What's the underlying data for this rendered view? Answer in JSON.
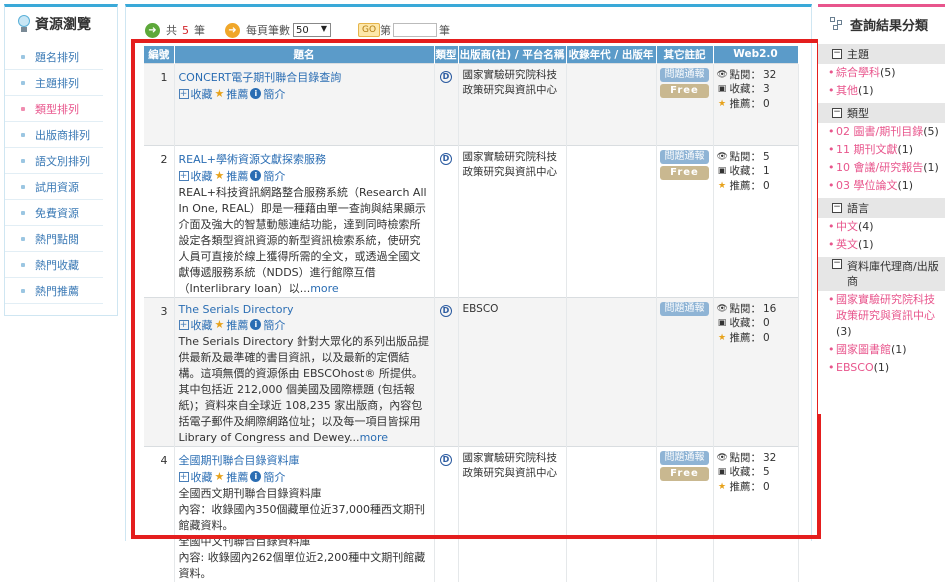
{
  "left": {
    "title": "資源瀏覽",
    "items": [
      "題名排列",
      "主題排列",
      "類型排列",
      "出版商排列",
      "語文別排列",
      "試用資源",
      "免費資源",
      "熱門點閱",
      "熱門收藏",
      "熱門推薦"
    ],
    "active_index": 2
  },
  "pager": {
    "total_prefix": "共",
    "total": "5",
    "total_suffix": "筆",
    "per_page_label": "每頁筆數",
    "per_page": "50",
    "go": "GO",
    "page_prefix": "第",
    "page_suffix": "筆"
  },
  "table": {
    "headers": [
      "編號",
      "題名",
      "類型",
      "出版商(社) / 平台名稱",
      "收錄年代 / 出版年",
      "其它註記",
      "Web2.0"
    ],
    "action_collect": "收藏",
    "action_recommend": "推薦",
    "action_intro": "簡介",
    "tag_notify": "問題通報",
    "tag_free": "Free",
    "label_views": "點閱：",
    "label_collect": "收藏：",
    "label_recommend": "推薦：",
    "type_letter": "D",
    "rows": [
      {
        "no": "1",
        "title": "CONCERT電子期刊聯合目錄查詢",
        "desc": "",
        "more": "",
        "publisher": "國家實驗研究院科技政策研究與資訊中心",
        "free": true,
        "views": "32",
        "collects": "3",
        "recommends": "0"
      },
      {
        "no": "2",
        "title": "REAL+學術資源文獻探索服務",
        "desc": "REAL+科技資訊網路整合服務系統（Research All In One, REAL）即是一種藉由單一查詢與結果顯示介面及強大的智慧動態連結功能，達到同時檢索所設定各類型資訊資源的新型資訊檢索系統，使研究人員可直接於線上獲得所需的全文，或透過全國文獻傳遞服務系統（NDDS）進行館際互借（Interlibrary loan）以...",
        "more": "more",
        "publisher": "國家實驗研究院科技政策研究與資訊中心",
        "free": true,
        "views": "5",
        "collects": "1",
        "recommends": "0"
      },
      {
        "no": "3",
        "title": "The Serials Directory",
        "desc": "The Serials Directory 針對大眾化的系列出版品提供最新及最準確的書目資訊，以及最新的定價結構。這項無價的資源係由 EBSCOhost® 所提供。其中包括近 212,000 個美國及國際標題 (包括報紙)；資料來自全球近 108,235 家出版商，內容包括電子郵件及網際網路位址；以及每一項目皆採用Library of Congress and Dewey...",
        "more": "more",
        "publisher": "EBSCO",
        "free": false,
        "views": "16",
        "collects": "0",
        "recommends": "0"
      },
      {
        "no": "4",
        "title": "全國期刊聯合目錄資料庫",
        "desc": "全國西文期刊聯合目錄資料庫\n內容：收錄國內350個藏單位近37,000種西文期刊館藏資料。\n全國中文刊聯合目錄資料庫\n內容: 收錄國內262個單位近2,200種中文期刊館藏資料。",
        "more": "",
        "publisher": "國家實驗研究院科技政策研究與資訊中心",
        "free": true,
        "views": "32",
        "collects": "5",
        "recommends": "0"
      }
    ]
  },
  "right": {
    "title": "查詢結果分類",
    "facets": [
      {
        "head": "主題",
        "items": [
          [
            "綜合學科",
            "(5)"
          ],
          [
            "其他",
            "(1)"
          ]
        ]
      },
      {
        "head": "類型",
        "items": [
          [
            "02 圖書/期刊目錄",
            "(5)"
          ],
          [
            "11 期刊文獻",
            "(1)"
          ],
          [
            "10 會議/研究報告",
            "(1)"
          ],
          [
            "03 學位論文",
            "(1)"
          ]
        ]
      },
      {
        "head": "語言",
        "items": [
          [
            "中文",
            "(4)"
          ],
          [
            "英文",
            "(1)"
          ]
        ]
      },
      {
        "head": "資料庫代理商/出版商",
        "items": [
          [
            "國家實驗研究院科技政策研究與資訊中心",
            "(3)"
          ],
          [
            "國家圖書館",
            "(1)"
          ],
          [
            "EBSCO",
            "(1)"
          ]
        ]
      }
    ]
  },
  "colors": {
    "accent": "#3aa9d8",
    "header": "#5b9bc9",
    "pink": "#e8558c",
    "highlight": "#e41e1e"
  }
}
